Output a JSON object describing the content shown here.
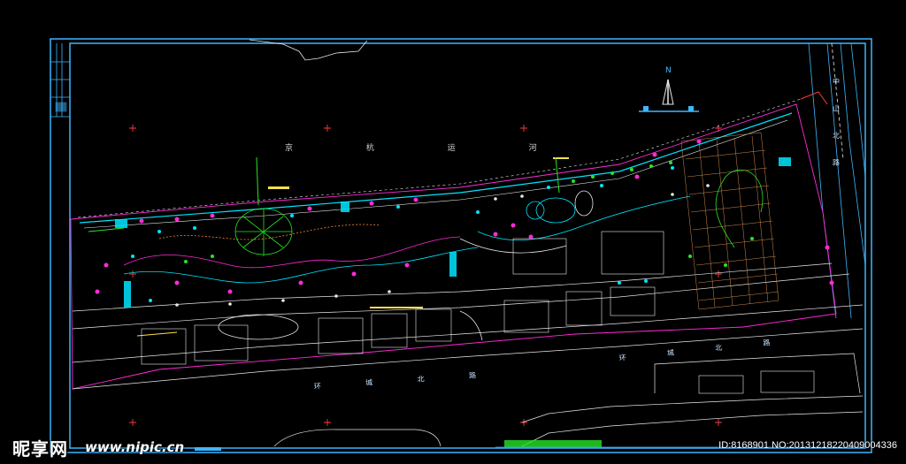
{
  "drawing": {
    "north_label": "N",
    "river_label": "京 杭 运 河",
    "right_road_label": "中 山 北 路",
    "bottom_road_label_1": "环 城 北 路",
    "bottom_road_label_2": "环 城 北 路",
    "frame_color": "#3fb6ff",
    "colors": {
      "cyan": "#00e5ff",
      "magenta": "#ff2bd6",
      "green": "#26e626",
      "yellow": "#ffe14a",
      "red": "#ff3b3b",
      "white": "#e8e8e8",
      "orange": "#ff8a3d"
    }
  },
  "watermark": {
    "logo_text": "昵享网",
    "url_text": "www.nipic.cn",
    "id_text": "ID:8168901 NO:20131218220409004336"
  }
}
